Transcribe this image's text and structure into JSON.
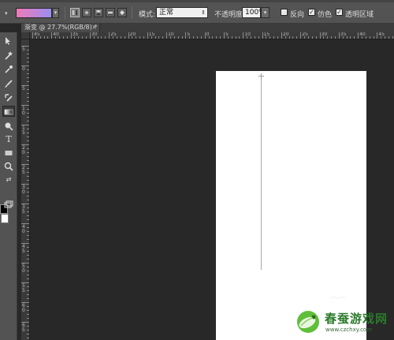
{
  "options_bar": {
    "gradient_colors": [
      "#f07ab7",
      "#9a8ef0"
    ],
    "gradient_types": [
      "linear",
      "radial",
      "angle",
      "reflected",
      "diamond"
    ],
    "selected_gradient_type": "linear",
    "mode_label": "模式:",
    "mode_value": "正常",
    "opacity_label": "不透明度:",
    "opacity_value": "100%",
    "reverse_label": "反向",
    "reverse_checked": false,
    "dither_label": "仿色",
    "dither_checked": true,
    "transparency_label": "透明区域",
    "transparency_checked": true
  },
  "document_tab": {
    "title": "渐变 @ 27.7%(RGB/8) *",
    "close_glyph": "×"
  },
  "ruler": {
    "horizontal_labels": [
      "45",
      "40",
      "35",
      "30",
      "25",
      "20",
      "15",
      "10",
      "5",
      "0",
      "5",
      "10",
      "15",
      "20",
      "25",
      "30",
      "35",
      "40",
      "45"
    ],
    "vertical_labels": [
      "5",
      "0",
      "5",
      "1 0",
      "1 5",
      "2 0",
      "2 5",
      "3 0",
      "3 5",
      "4 0",
      "4 5",
      "5 0",
      "5 5",
      "6 0",
      "6 5"
    ]
  },
  "tools": [
    {
      "name": "move-tool",
      "icon": "move-icon"
    },
    {
      "name": "magic-wand-tool",
      "icon": "magic-wand-icon"
    },
    {
      "name": "eyedropper-tool",
      "icon": "eyedropper-icon"
    },
    {
      "name": "brush-tool",
      "icon": "brush-icon"
    },
    {
      "name": "history-brush-tool",
      "icon": "history-brush-icon"
    },
    {
      "name": "gradient-tool",
      "icon": "gradient-icon",
      "selected": true
    },
    {
      "name": "dodge-tool",
      "icon": "dodge-icon"
    },
    {
      "name": "type-tool",
      "icon": "type-icon",
      "glyph": "T"
    },
    {
      "name": "rectangle-tool",
      "icon": "rectangle-icon"
    },
    {
      "name": "zoom-tool",
      "icon": "zoom-icon"
    }
  ],
  "colors": {
    "foreground": "#000000",
    "background": "#ffffff",
    "canvas_bg": "#282828",
    "panel_bg": "#535353"
  },
  "watermark": {
    "title": "春蚕游戏网",
    "url": "www.czchxy.com"
  }
}
